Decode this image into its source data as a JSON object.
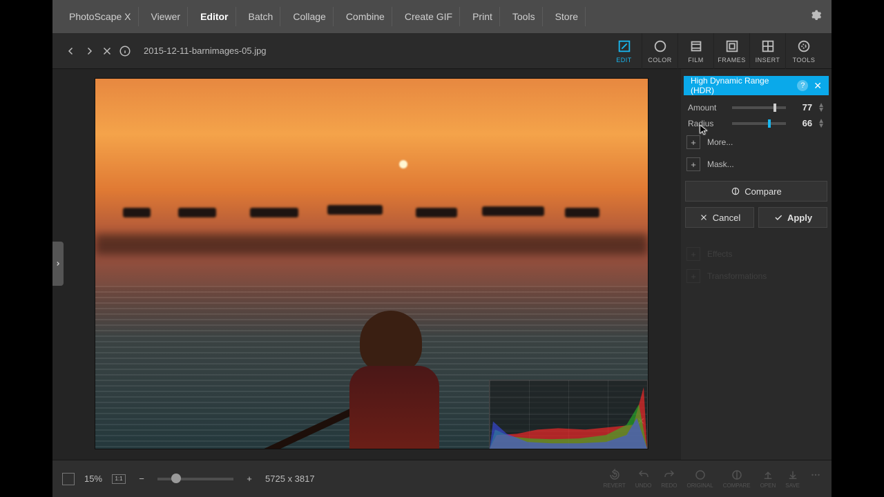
{
  "top_tabs": {
    "app_name": "PhotoScape X",
    "items": [
      "Viewer",
      "Editor",
      "Batch",
      "Collage",
      "Combine",
      "Create GIF",
      "Print",
      "Tools",
      "Store"
    ],
    "active_index": 1
  },
  "toolbar": {
    "filename": "2015-12-11-barnimages-05.jpg",
    "categories": [
      "EDIT",
      "COLOR",
      "FILM",
      "FRAMES",
      "INSERT",
      "TOOLS"
    ],
    "active_category": 0
  },
  "panel": {
    "title": "High Dynamic Range (HDR)",
    "amount_label": "Amount",
    "amount_value": "77",
    "amount_pct": 77,
    "radius_label": "Radius",
    "radius_value": "66",
    "radius_pct": 66,
    "more_label": "More...",
    "mask_label": "Mask...",
    "compare_label": "Compare",
    "cancel_label": "Cancel",
    "apply_label": "Apply",
    "ghost_effects": "Effects",
    "ghost_transforms": "Transformations"
  },
  "bottom": {
    "zoom_label": "15%",
    "one_to_one": "1:1",
    "dimensions": "5725 x 3817",
    "actions": [
      "REVERT",
      "UNDO",
      "REDO",
      "ORIGINAL",
      "COMPARE",
      "OPEN",
      "SAVE"
    ]
  }
}
